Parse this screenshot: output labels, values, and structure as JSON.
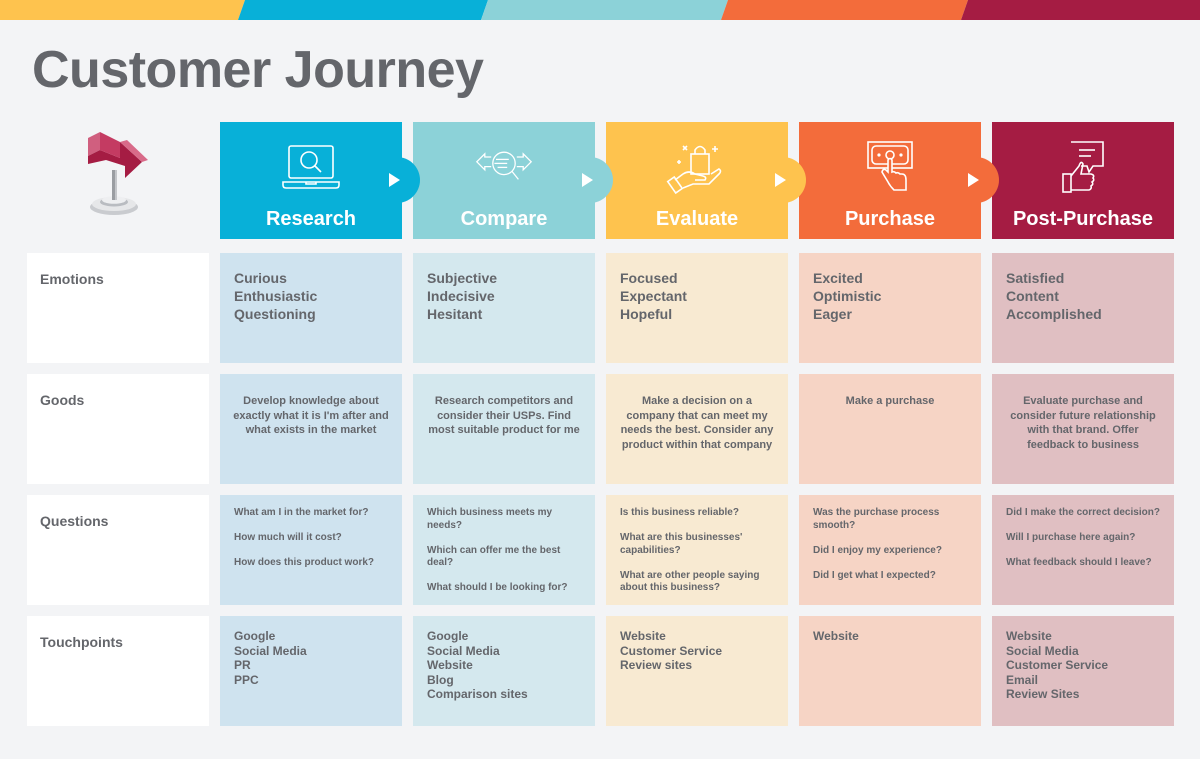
{
  "title": "Customer Journey",
  "colors": {
    "research": "#08b0d8",
    "compare": "#8cd2d8",
    "evaluate": "#fec34e",
    "purchase": "#f36c3b",
    "post_purchase": "#a51c43",
    "research_light": "#cfe3ef",
    "compare_light": "#d4e8ee",
    "evaluate_light": "#f8ead2",
    "purchase_light": "#f6d4c5",
    "post_purchase_light": "#e0bfc2"
  },
  "stages": [
    {
      "label": "Research",
      "icon": "laptop-search-icon"
    },
    {
      "label": "Compare",
      "icon": "compare-magnifier-icon"
    },
    {
      "label": "Evaluate",
      "icon": "hand-shopping-bag-icon"
    },
    {
      "label": "Purchase",
      "icon": "cash-tap-icon"
    },
    {
      "label": "Post-Purchase",
      "icon": "thumbs-up-feedback-icon"
    }
  ],
  "rows": [
    {
      "label": "Emotions"
    },
    {
      "label": "Goods"
    },
    {
      "label": "Questions"
    },
    {
      "label": "Touchpoints"
    }
  ],
  "emotions": [
    [
      "Curious",
      "Enthusiastic",
      "Questioning"
    ],
    [
      "Subjective",
      "Indecisive",
      "Hesitant"
    ],
    [
      "Focused",
      "Expectant",
      "Hopeful"
    ],
    [
      "Excited",
      "Optimistic",
      "Eager"
    ],
    [
      "Satisfied",
      "Content",
      "Accomplished"
    ]
  ],
  "goods": [
    "Develop knowledge about exactly what it is I'm after and what exists in the market",
    "Research competitors and consider their USPs. Find most suitable product for me",
    "Make a decision on a company that can meet my needs the best. Consider any product within that company",
    "Make a purchase",
    "Evaluate purchase and consider future relationship with that brand. Offer feedback to business"
  ],
  "questions": [
    [
      "What am I in the market for?",
      "How much will it cost?",
      "How does this product work?"
    ],
    [
      "Which business meets my needs?",
      "Which can offer me the best deal?",
      "What should I be looking for?"
    ],
    [
      "Is this business reliable?",
      "What are this businesses' capabilities?",
      "What are other people saying about this business?"
    ],
    [
      "Was the purchase process smooth?",
      "Did I enjoy my experience?",
      "Did I get what I expected?"
    ],
    [
      "Did I make the correct decision?",
      "Will I purchase here again?",
      "What feedback should I leave?"
    ]
  ],
  "touchpoints": [
    [
      "Google",
      "Social Media",
      "PR",
      "PPC"
    ],
    [
      "Google",
      "Social Media",
      "Website",
      "Blog",
      "Comparison sites"
    ],
    [
      "Website",
      "Customer Service",
      "Review sites"
    ],
    [
      "Website"
    ],
    [
      "Website",
      "Social Media",
      "Customer Service",
      "Email",
      "Review Sites"
    ]
  ]
}
